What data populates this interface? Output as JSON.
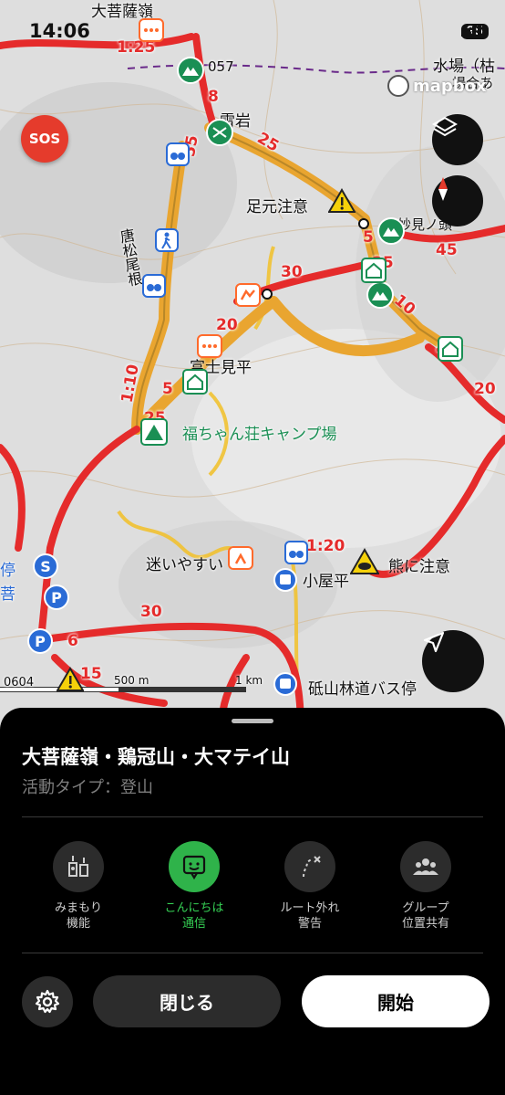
{
  "status_bar": {
    "time": "14:06",
    "battery": "95"
  },
  "map": {
    "mapbox_label": "mapbox",
    "scale_500": "500 m",
    "scale_1km": "1 km",
    "labels": {
      "daibosatsu": "大菩薩嶺",
      "raigan": "雷岩",
      "mizuba": "水場（枯",
      "mizuba2": "場合あ",
      "ashimoto": "足元注意",
      "myoken": "妙見ノ頭",
      "karamatsu": "唐松尾根",
      "fujimidaira": "富士見平",
      "fukuchan": "福ちゃん荘キャンプ場",
      "mayoi": "迷いやすい",
      "kuma": "熊に注意",
      "koyadaira": "小屋平",
      "busstop": "砥山林道バス停",
      "left1": "停",
      "left2": "菩",
      "elev057": "057",
      "elev0604": "0604"
    },
    "route_times": {
      "t125": "1:25",
      "t8": "8",
      "t55": "55",
      "t25a": "25",
      "t5a": "5",
      "t45": "45",
      "t25b": "25",
      "t30a": "30",
      "t10": "10",
      "t20a": "20",
      "t40": "40",
      "t20b": "20",
      "t110": "1:10",
      "t5b": "5",
      "t25c": "25",
      "t120": "1:20",
      "t30b": "30",
      "t6": "6",
      "t15": "15"
    }
  },
  "sos_label": "SOS",
  "sheet": {
    "title": "大菩薩嶺・鶏冠山・大マテイ山",
    "activity": "活動タイプ：登山",
    "features": [
      {
        "label": "みまもり\n機能",
        "icon": "watch-over-icon"
      },
      {
        "label": "こんにちは\n通信",
        "icon": "hello-chat-icon"
      },
      {
        "label": "ルート外れ\n警告",
        "icon": "route-deviation-icon"
      },
      {
        "label": "グループ\n位置共有",
        "icon": "group-icon"
      }
    ],
    "close_label": "閉じる",
    "start_label": "開始"
  },
  "colors": {
    "route_red": "#e52b2b",
    "trail_yellow": "#f1c232",
    "accent_green": "#2fb34a"
  }
}
